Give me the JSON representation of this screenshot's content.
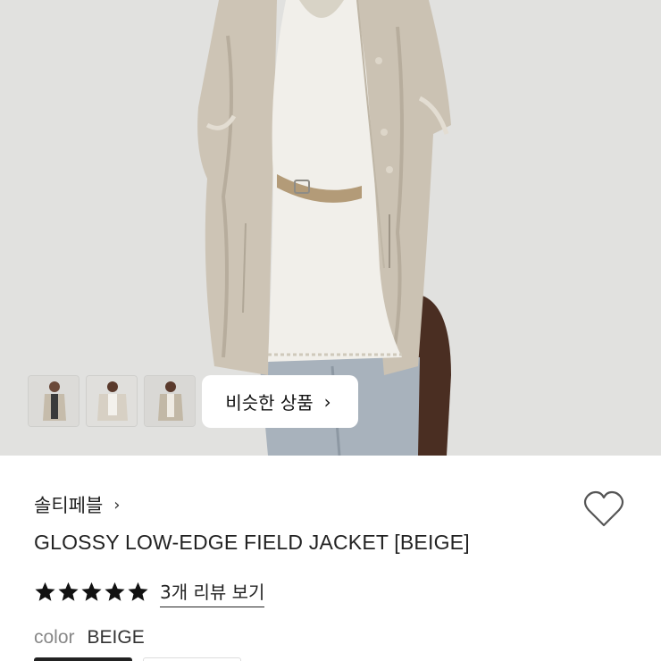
{
  "hero": {
    "similar_button": {
      "label": "비슷한 상품",
      "chevron": "›"
    },
    "thumbnails": [
      "product-thumb-1",
      "product-thumb-2",
      "product-thumb-3"
    ]
  },
  "product": {
    "brand": "솔티페블",
    "brand_chevron": "›",
    "title": "GLOSSY LOW-EDGE FIELD JACKET [BEIGE]",
    "rating_stars": 5,
    "review_link": "3개 리뷰 보기",
    "color_label": "color",
    "color_value": "BEIGE",
    "wishlist_icon": "heart-outline-icon"
  },
  "colors": {
    "hero_bg": "#e1e1df",
    "jacket": "#cfc6b8",
    "text": "#222222",
    "muted": "#888888"
  }
}
